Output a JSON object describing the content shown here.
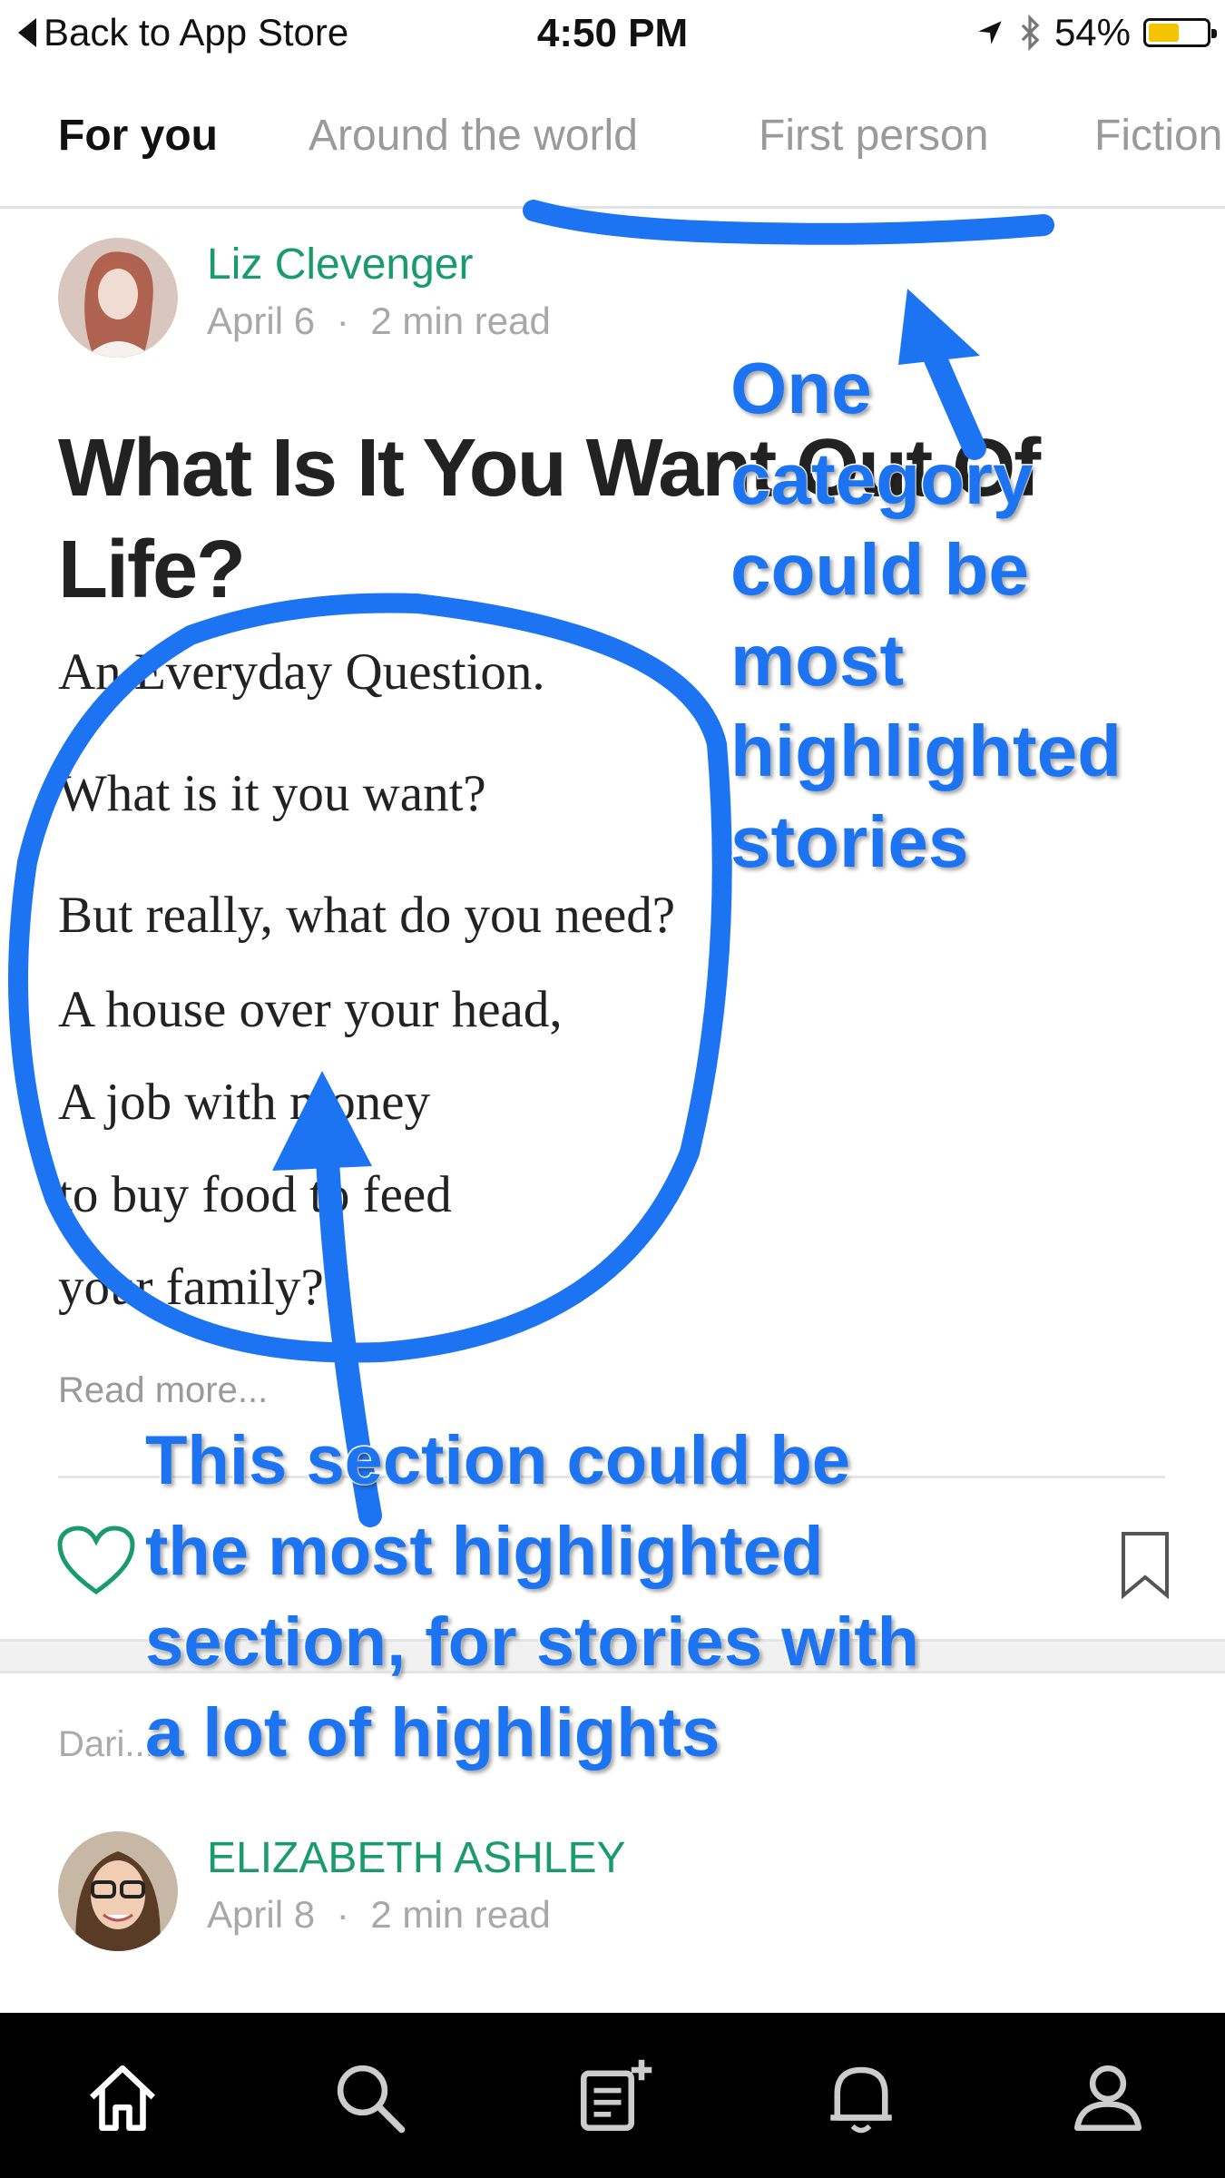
{
  "status_bar": {
    "back_label": "Back to App Store",
    "time": "4:50 PM",
    "battery": "54%",
    "battery_level": 0.54,
    "battery_color": "#f5c400"
  },
  "tabs": [
    {
      "label": "For you",
      "active": true
    },
    {
      "label": "Around the world",
      "active": false
    },
    {
      "label": "First person",
      "active": false
    },
    {
      "label": "Fiction",
      "active": false
    }
  ],
  "post": {
    "author": "Liz Clevenger",
    "date": "April 6",
    "separator": "·",
    "read_time": "2 min read",
    "title": "What Is It You Want Out Of Life?",
    "body_lines": [
      "An Everyday Question.",
      "What is it you want?",
      "But really, what do you need?",
      "A house over your head,",
      "A job with money",
      "to buy food to feed",
      "your family?"
    ],
    "read_more": "Read more...",
    "icons": {
      "like": "heart-icon",
      "save": "bookmark-icon"
    }
  },
  "next_section": {
    "label": "Dari..."
  },
  "next_post": {
    "author": "ELIZABETH ASHLEY",
    "date": "April 8",
    "separator": "·",
    "read_time": "2 min read"
  },
  "bottom_nav": [
    {
      "icon": "home-icon"
    },
    {
      "icon": "search-icon"
    },
    {
      "icon": "compose-icon"
    },
    {
      "icon": "bell-icon"
    },
    {
      "icon": "profile-icon"
    }
  ],
  "annotations": {
    "category_note": "One\ncategory\ncould be\nmost\nhighlighted\nstories",
    "section_note": "This section could be\nthe most highlighted\nsection, for stories with\na lot of highlights",
    "color": "#1c74f2"
  },
  "colors": {
    "accent_green": "#1a9b6c",
    "muted_gray": "#9a9a9a",
    "nav_bg": "#000000"
  }
}
